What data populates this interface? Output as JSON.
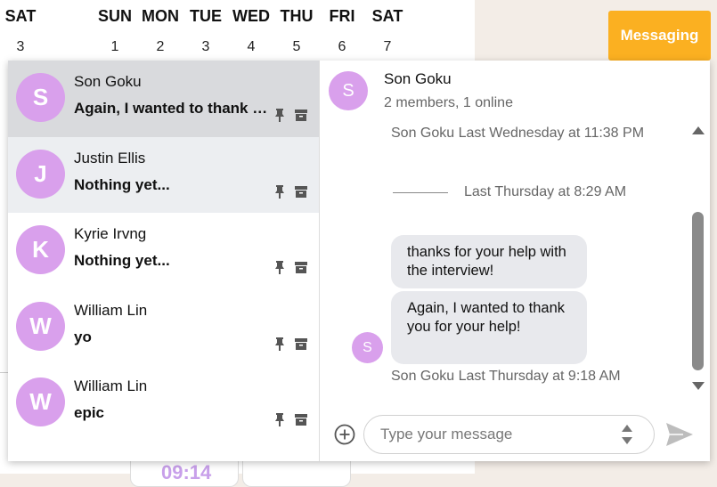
{
  "calendar": {
    "days": [
      "SAT",
      "SUN",
      "MON",
      "TUE",
      "WED",
      "THU",
      "FRI",
      "SAT"
    ],
    "dates": [
      "3",
      "1",
      "2",
      "3",
      "4",
      "5",
      "6",
      "7"
    ]
  },
  "background": {
    "timer_text": "09:14"
  },
  "messaging_button": "Messaging",
  "conversations": [
    {
      "initial": "S",
      "name": "Son Goku",
      "preview": "Again, I wanted to thank you for your help!"
    },
    {
      "initial": "J",
      "name": "Justin Ellis",
      "preview": "Nothing yet..."
    },
    {
      "initial": "K",
      "name": "Kyrie Irvng",
      "preview": "Nothing yet..."
    },
    {
      "initial": "W",
      "name": "William Lin",
      "preview": "yo"
    },
    {
      "initial": "W",
      "name": "William Lin",
      "preview": "epic"
    }
  ],
  "detail": {
    "initial": "S",
    "name": "Son Goku",
    "subtitle": "2 members, 1 online",
    "meta_top": "Son Goku Last Wednesday at 11:38 PM",
    "divider_label": "Last Thursday at 8:29 AM",
    "messages": [
      "thanks for your help with the interview!",
      "Again, I wanted to thank you for your help!"
    ],
    "sender_initial": "S",
    "meta_bottom": "Son Goku Last Thursday at 9:18 AM"
  },
  "composer": {
    "placeholder": "Type your message"
  },
  "colors": {
    "accent": "#fbb021",
    "avatar": "#d9a0ec"
  }
}
